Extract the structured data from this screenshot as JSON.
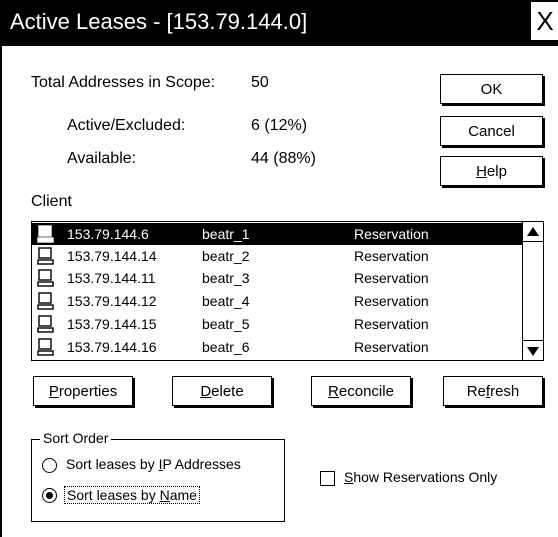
{
  "window": {
    "title": "Active Leases - [153.79.144.0]",
    "close_label": "X"
  },
  "summary": {
    "total_label": "Total Addresses in Scope:",
    "total_value": "50",
    "active_label": "Active/Excluded:",
    "active_value": "6 (12%)",
    "available_label": "Available:",
    "available_value": "44 (88%)"
  },
  "buttons": {
    "ok": "OK",
    "cancel": "Cancel",
    "help_pre": "",
    "help_ul": "H",
    "help_post": "elp"
  },
  "client_label": "Client",
  "leases": [
    {
      "ip": "153.79.144.6",
      "name": "beatr_1",
      "type": "Reservation",
      "icon": "computer-icon",
      "selected": true
    },
    {
      "ip": "153.79.144.14",
      "name": "beatr_2",
      "type": "Reservation",
      "icon": "computer-icon",
      "selected": false
    },
    {
      "ip": "153.79.144.11",
      "name": "beatr_3",
      "type": "Reservation",
      "icon": "computer-icon",
      "selected": false
    },
    {
      "ip": "153.79.144.12",
      "name": "beatr_4",
      "type": "Reservation",
      "icon": "computer-icon",
      "selected": false
    },
    {
      "ip": "153.79.144.15",
      "name": "beatr_5",
      "type": "Reservation",
      "icon": "computer-icon",
      "selected": false
    },
    {
      "ip": "153.79.144.16",
      "name": "beatr_6",
      "type": "Reservation",
      "icon": "computer-icon",
      "selected": false
    }
  ],
  "actions": {
    "properties_ul": "P",
    "properties_rest": "roperties",
    "delete_ul": "D",
    "delete_rest": "elete",
    "reconcile_ul": "R",
    "reconcile_rest": "econcile",
    "refresh_pre": "Re",
    "refresh_ul": "f",
    "refresh_post": "resh"
  },
  "sort_order": {
    "legend": "Sort Order",
    "by_ip_pre": "Sort leases by ",
    "by_ip_ul": "I",
    "by_ip_post": "P Addresses",
    "by_name_pre": "Sort leases by ",
    "by_name_ul": "N",
    "by_name_post": "ame",
    "selected": "name"
  },
  "show_reservations": {
    "ul": "S",
    "rest": "how Reservations Only",
    "checked": false
  }
}
